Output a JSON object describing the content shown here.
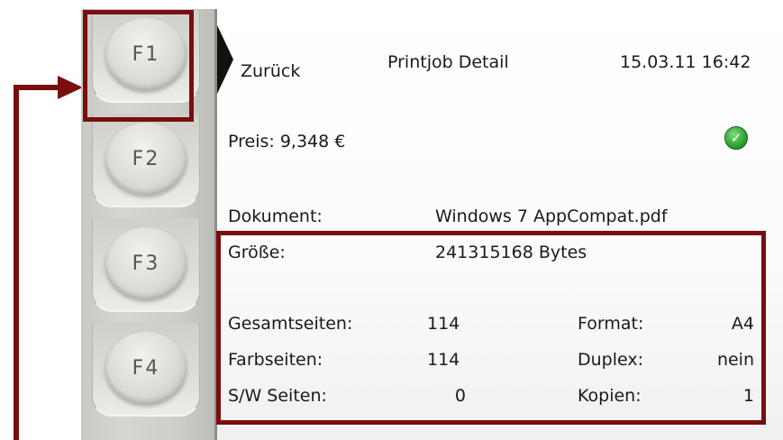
{
  "keypad": {
    "keys": [
      "F1",
      "F2",
      "F3",
      "F4"
    ]
  },
  "header": {
    "back_label": "Zurück",
    "title": "Printjob Detail",
    "datetime": "15.03.11 16:42"
  },
  "price": {
    "text": "Preis: 9,348 €",
    "status_icon": "check-circle-icon"
  },
  "document": {
    "label": "Dokument:",
    "value": "Windows 7 AppCompat.pdf"
  },
  "size": {
    "label": "Größe:",
    "value": "241315168 Bytes"
  },
  "stats": [
    {
      "label": "Gesamtseiten:",
      "value": "114",
      "label2": "Format:",
      "value2": "A4"
    },
    {
      "label": "Farbseiten:",
      "value": "114",
      "label2": "Duplex:",
      "value2": "nein"
    },
    {
      "label": "S/W Seiten:",
      "value": "0",
      "label2": "Kopien:",
      "value2": "1"
    }
  ],
  "colors": {
    "highlight": "#7a0e0e",
    "ok_green": "#2ea12e"
  }
}
